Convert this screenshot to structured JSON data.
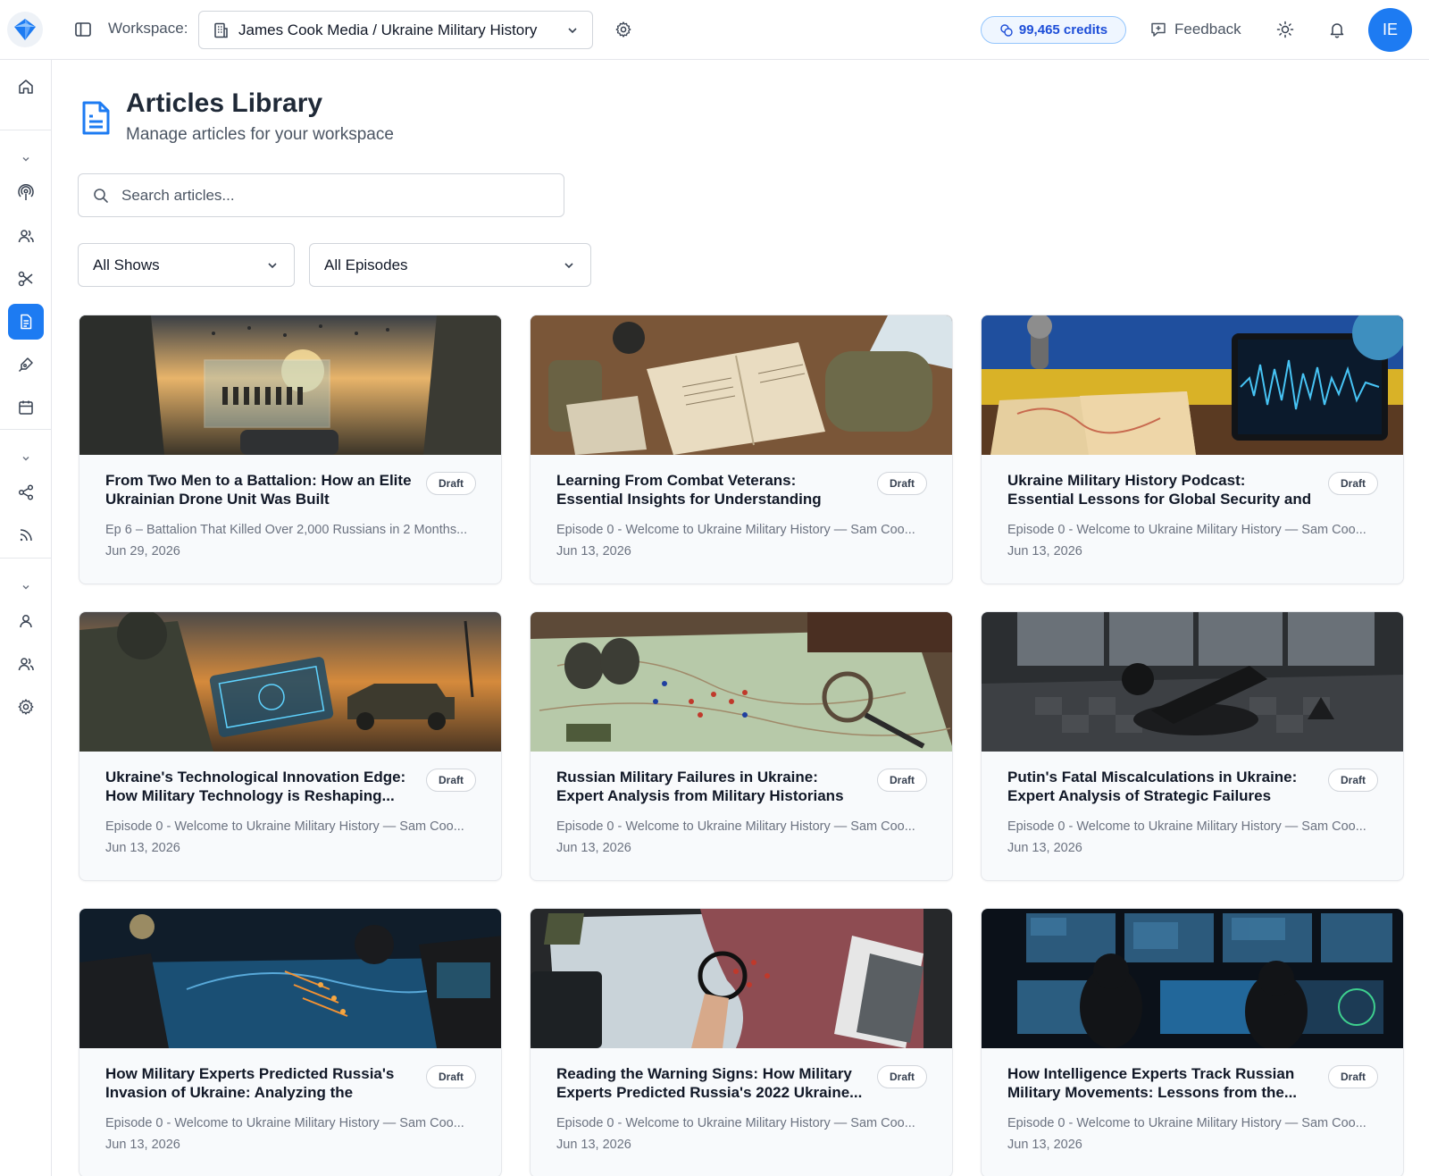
{
  "topbar": {
    "workspace_label": "Workspace:",
    "workspace_value": "James Cook Media / Ukraine Military History",
    "credits": "99,465 credits",
    "feedback": "Feedback",
    "avatar_initials": "IE"
  },
  "header": {
    "title": "Articles Library",
    "subtitle": "Manage articles for your workspace"
  },
  "search": {
    "placeholder": "Search articles..."
  },
  "filters": {
    "shows": "All Shows",
    "episodes": "All Episodes"
  },
  "colors": {
    "accent": "#1d7bf2",
    "credits_text": "#1d4ed8"
  },
  "articles": [
    {
      "title": "From Two Men to a Battalion: How an Elite Ukrainian Drone Unit Was Built",
      "badge": "Draft",
      "episode": "Ep 6 – Battalion That Killed Over 2,000 Russians in 2 Months...",
      "date": "Jun 29, 2026"
    },
    {
      "title": "Learning From Combat Veterans: Essential Insights for Understanding Modern Milita...",
      "badge": "Draft",
      "episode": "Episode 0 - Welcome to Ukraine Military History — Sam Coo...",
      "date": "Jun 13, 2026"
    },
    {
      "title": "Ukraine Military History Podcast: Essential Lessons for Global Security and Defense...",
      "badge": "Draft",
      "episode": "Episode 0 - Welcome to Ukraine Military History — Sam Coo...",
      "date": "Jun 13, 2026"
    },
    {
      "title": "Ukraine's Technological Innovation Edge: How Military Technology is Reshaping...",
      "badge": "Draft",
      "episode": "Episode 0 - Welcome to Ukraine Military History — Sam Coo...",
      "date": "Jun 13, 2026"
    },
    {
      "title": "Russian Military Failures in Ukraine: Expert Analysis from Military Historians",
      "badge": "Draft",
      "episode": "Episode 0 - Welcome to Ukraine Military History — Sam Coo...",
      "date": "Jun 13, 2026"
    },
    {
      "title": "Putin's Fatal Miscalculations in Ukraine: Expert Analysis of Strategic Failures",
      "badge": "Draft",
      "episode": "Episode 0 - Welcome to Ukraine Military History — Sam Coo...",
      "date": "Jun 13, 2026"
    },
    {
      "title": "How Military Experts Predicted Russia's Invasion of Ukraine: Analyzing the Warnin...",
      "badge": "Draft",
      "episode": "Episode 0 - Welcome to Ukraine Military History — Sam Coo...",
      "date": "Jun 13, 2026"
    },
    {
      "title": "Reading the Warning Signs: How Military Experts Predicted Russia's 2022 Ukraine...",
      "badge": "Draft",
      "episode": "Episode 0 - Welcome to Ukraine Military History — Sam Coo...",
      "date": "Jun 13, 2026"
    },
    {
      "title": "How Intelligence Experts Track Russian Military Movements: Lessons from the...",
      "badge": "Draft",
      "episode": "Episode 0 - Welcome to Ukraine Military History — Sam Coo...",
      "date": "Jun 13, 2026"
    }
  ]
}
